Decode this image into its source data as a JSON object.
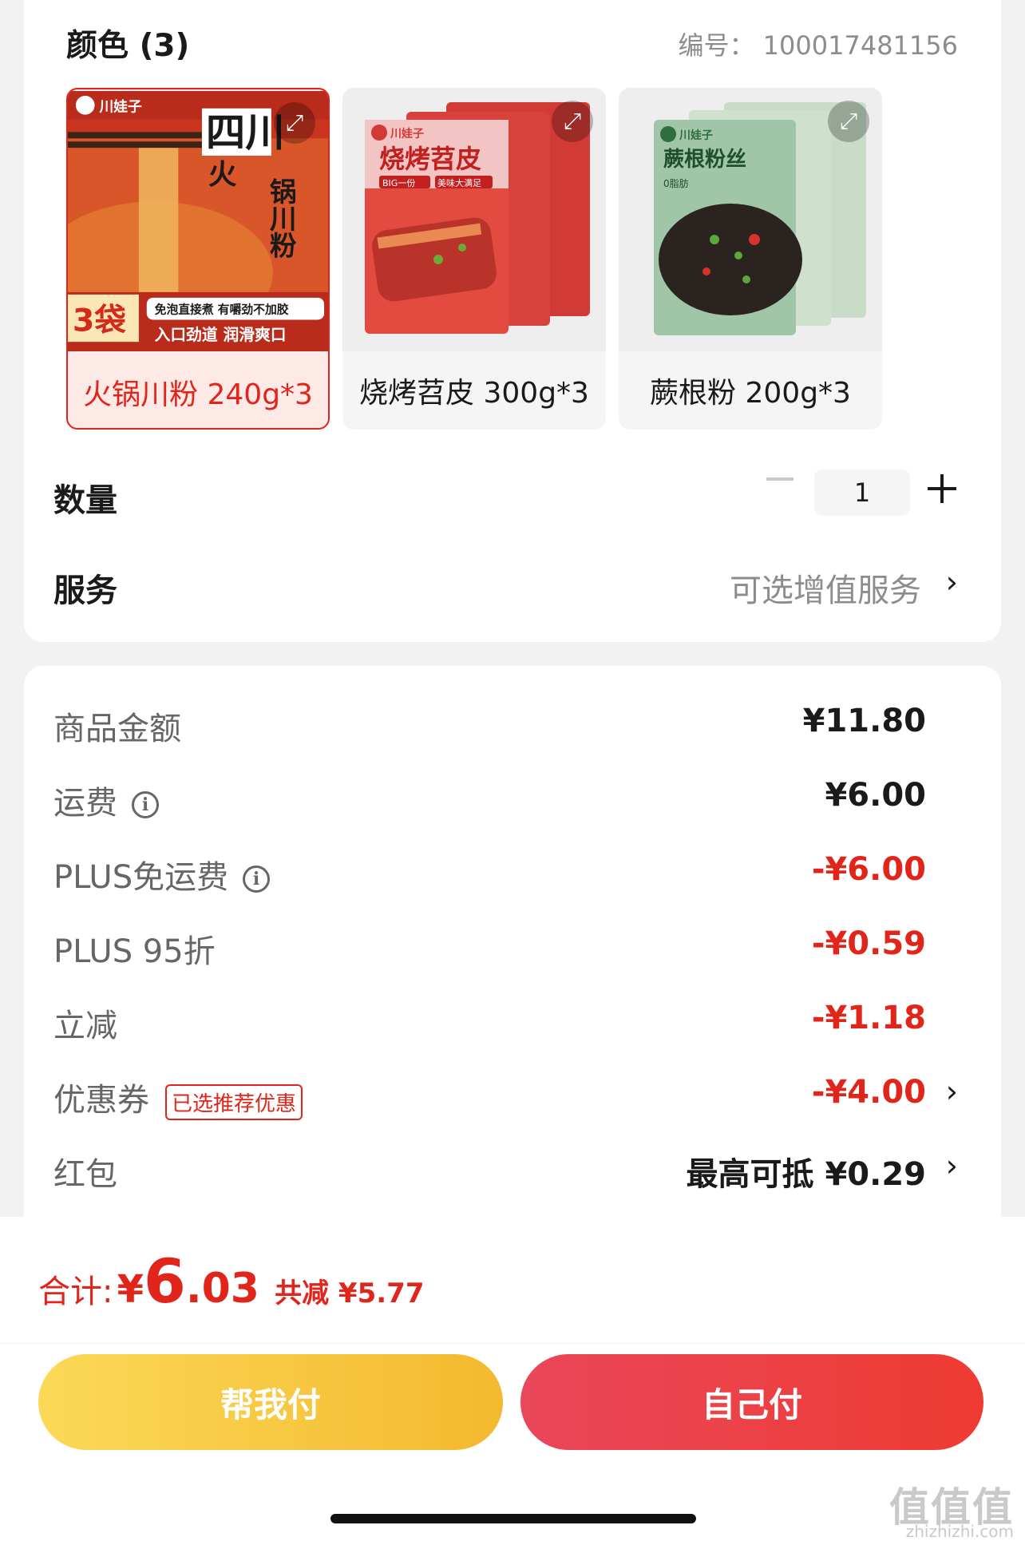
{
  "variants_section": {
    "title": "颜色 (3)",
    "code": "编号： 100017481156"
  },
  "variants": [
    {
      "label": "火锅川粉 240g*3",
      "selected": true
    },
    {
      "label": "烧烤苕皮 300g*3",
      "selected": false
    },
    {
      "label": "蕨根粉 200g*3",
      "selected": false
    }
  ],
  "product_images": {
    "v1": {
      "title_a": "四川",
      "title_b": "火",
      "title_c": "锅川粉",
      "badge": "3袋",
      "line1": "免泡直接煮 有嚼劲不加胶",
      "line2": "入口劲道 润滑爽口",
      "brand": "川娃子"
    },
    "v2": {
      "title": "烧烤苕皮",
      "tag1": "BIG一份",
      "tag2": "美味大满足",
      "brand": "川娃子"
    },
    "v3": {
      "title": "蕨根粉丝",
      "tag": "0脂肪",
      "brand": "川娃子"
    }
  },
  "quantity": {
    "label": "数量",
    "value": "1"
  },
  "service": {
    "label": "服务",
    "value": "可选增值服务"
  },
  "fees": [
    {
      "label": "商品金额",
      "value": "¥11.80",
      "info": false,
      "red": false,
      "chevron": false
    },
    {
      "label": "运费",
      "value": "¥6.00",
      "info": true,
      "red": false,
      "chevron": false
    },
    {
      "label": "PLUS免运费",
      "value": "-¥6.00",
      "info": true,
      "red": true,
      "chevron": false
    },
    {
      "label": "PLUS 95折",
      "value": "-¥0.59",
      "info": false,
      "red": true,
      "chevron": false
    },
    {
      "label": "立减",
      "value": "-¥1.18",
      "info": false,
      "red": true,
      "chevron": false
    },
    {
      "label": "优惠券",
      "badge": "已选推荐优惠",
      "value": "-¥4.00",
      "info": false,
      "red": true,
      "chevron": true
    },
    {
      "label": "红包",
      "value": "最高可抵 ¥0.29",
      "info": false,
      "red": false,
      "chevron": true
    }
  ],
  "total": {
    "label": "合计:",
    "currency": "¥",
    "integer": "6",
    "decimal": ".03",
    "saved": "共减 ¥5.77"
  },
  "buttons": {
    "help_pay": "帮我付",
    "self_pay": "自己付"
  },
  "icons": {
    "info": "i",
    "chevron": "›",
    "expand": "⤢"
  },
  "watermark": {
    "main": "值值值",
    "sub": "zhizhizhi.com"
  },
  "colors": {
    "accent_red": "#e1251b",
    "help_btn": "#f4c43a",
    "self_btn": "#ec4148"
  }
}
